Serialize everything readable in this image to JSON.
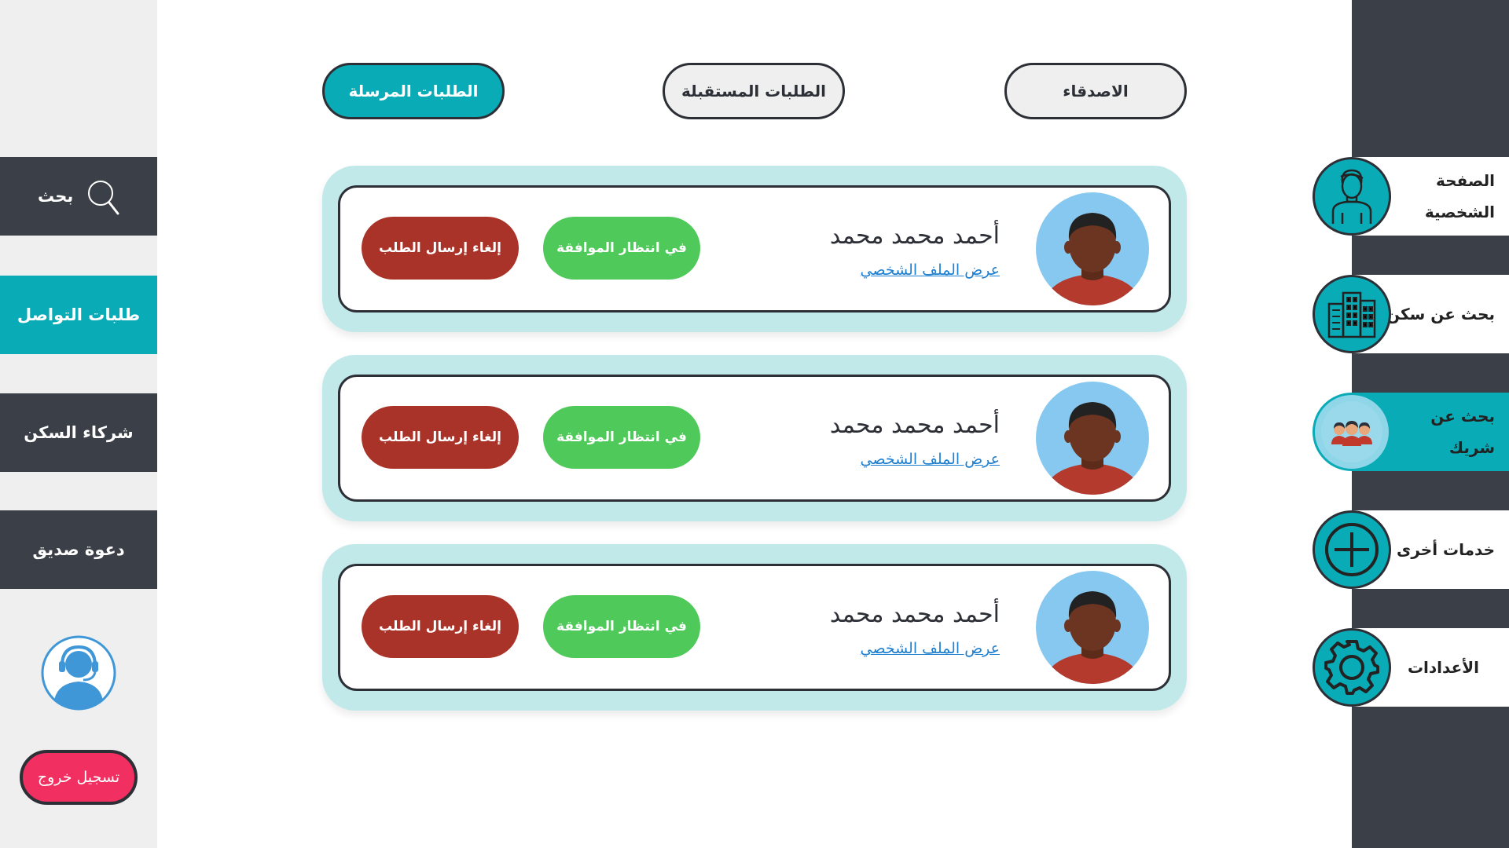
{
  "tabs": [
    {
      "label": "الاصدقاء",
      "active": false
    },
    {
      "label": "الطلبات المستقبلة",
      "active": false
    },
    {
      "label": "الطلبات المرسلة",
      "active": true
    }
  ],
  "left_nav": {
    "search": {
      "label": "بحث",
      "icon": "magnifier-icon"
    },
    "items": [
      {
        "label": "طلبات التواصل",
        "active": true
      },
      {
        "label": "شركاء السكن",
        "active": false
      },
      {
        "label": "دعوة صديق",
        "active": false
      }
    ],
    "support_icon": "customer-support-icon",
    "logout_label": "تسجيل خروج"
  },
  "right_nav": [
    {
      "label": "الصفحة الشخصية",
      "icon": "user-profile-icon",
      "active": false
    },
    {
      "label": "بحث عن سكن",
      "icon": "building-icon",
      "active": false
    },
    {
      "label": "بحث عن شريك",
      "icon": "people-group-icon",
      "active": true
    },
    {
      "label": "خدمات أخرى",
      "icon": "plus-circle-icon",
      "active": false
    },
    {
      "label": "الأعدادات",
      "icon": "gear-icon",
      "active": false
    }
  ],
  "requests": [
    {
      "name": "أحمد محمد محمد",
      "profile_link": "عرض الملف الشخصي",
      "status": "في انتظار الموافقة",
      "cancel": "إلغاء إرسال الطلب"
    },
    {
      "name": "أحمد محمد محمد",
      "profile_link": "عرض الملف الشخصي",
      "status": "في انتظار الموافقة",
      "cancel": "إلغاء إرسال الطلب"
    },
    {
      "name": "أحمد محمد محمد",
      "profile_link": "عرض الملف الشخصي",
      "status": "في انتظار الموافقة",
      "cancel": "إلغاء إرسال الطلب"
    }
  ],
  "colors": {
    "accent": "#09abb6",
    "dark": "#3b3f47",
    "pending": "#4fc95a",
    "cancel": "#a93328",
    "logout": "#f12f60",
    "card_bg": "#c2e9ea",
    "link": "#1e7fd0"
  }
}
